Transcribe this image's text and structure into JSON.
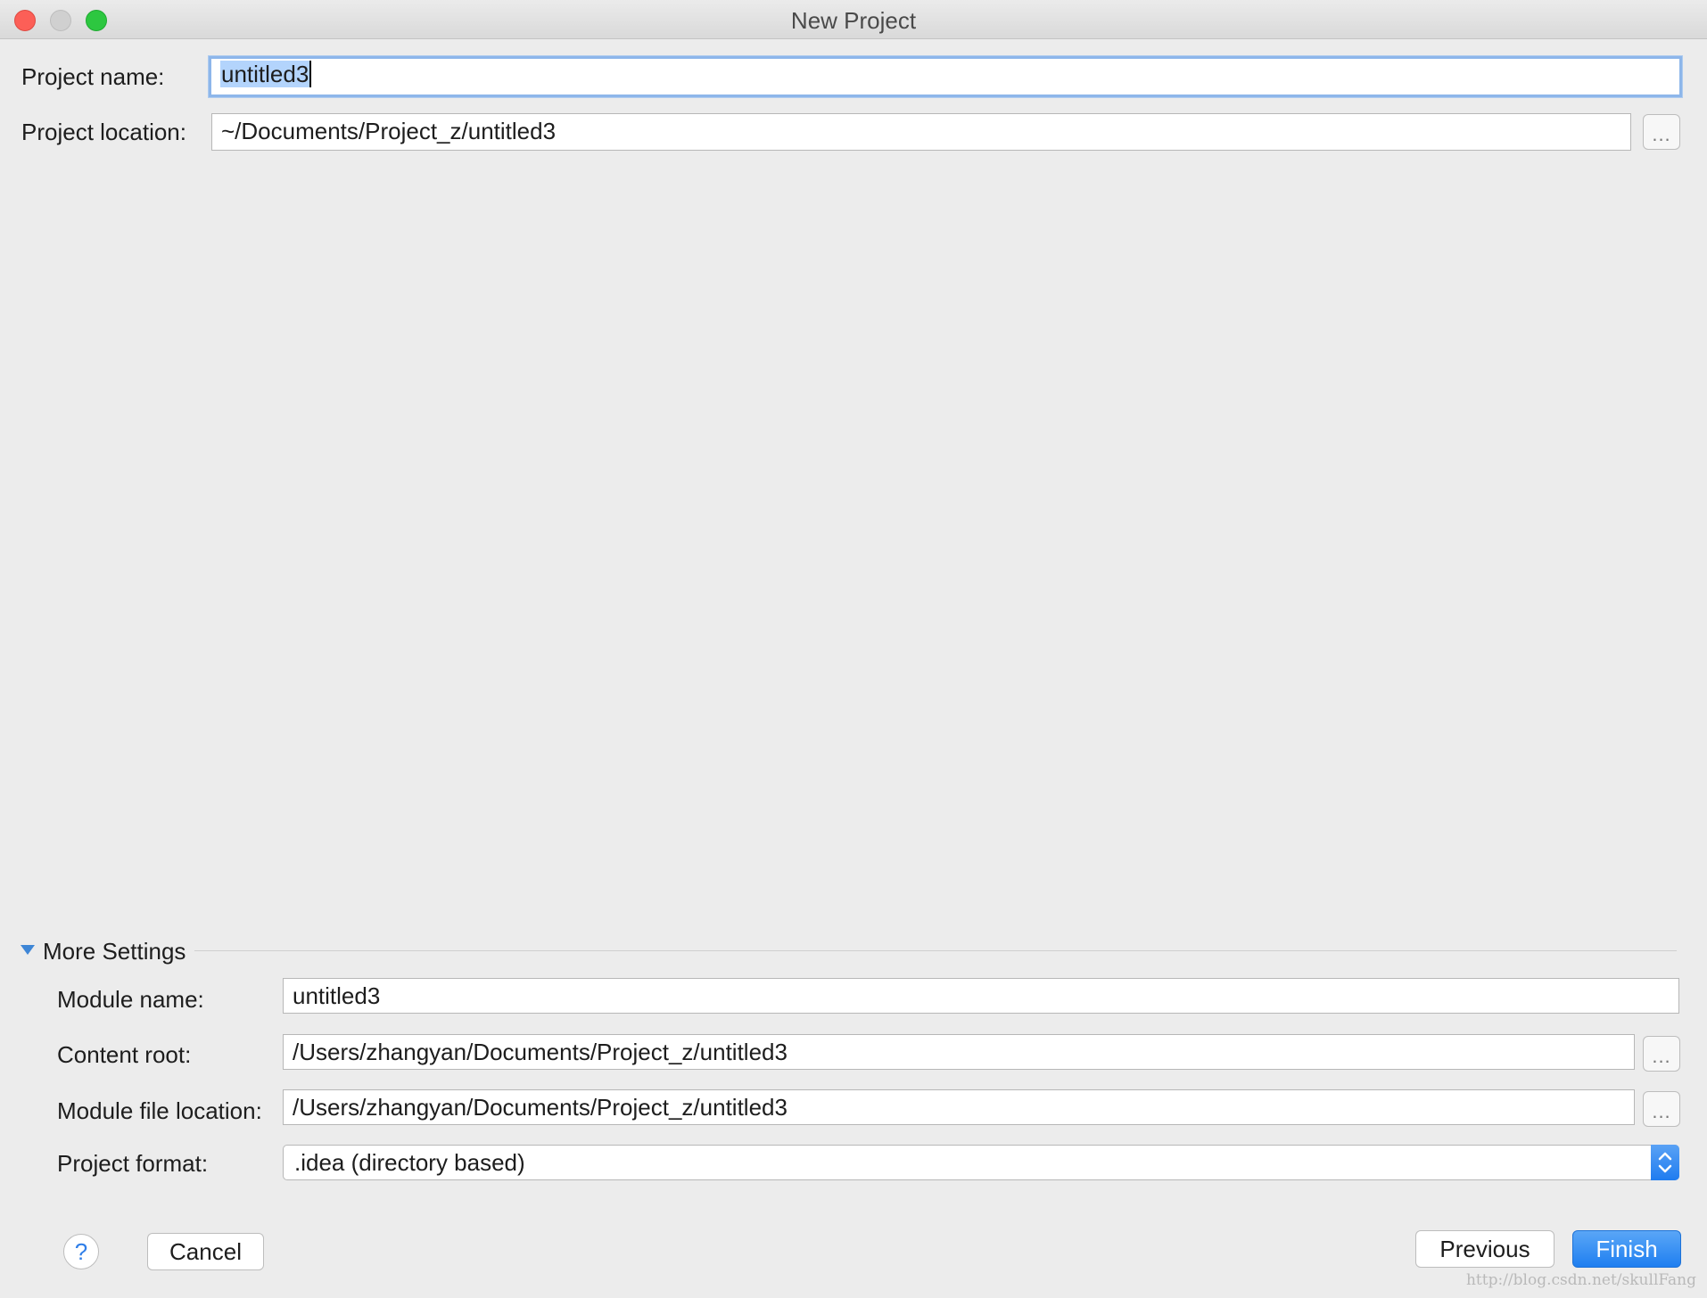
{
  "window": {
    "title": "New Project"
  },
  "project": {
    "name_label": "Project name:",
    "name_value": "untitled3",
    "location_label": "Project location:",
    "location_value": "~/Documents/Project_z/untitled3",
    "browse_label": "..."
  },
  "more_settings": {
    "title": "More Settings",
    "expanded": true,
    "module_name_label": "Module name:",
    "module_name_value": "untitled3",
    "content_root_label": "Content root:",
    "content_root_value": "/Users/zhangyan/Documents/Project_z/untitled3",
    "module_file_label": "Module file location:",
    "module_file_value": "/Users/zhangyan/Documents/Project_z/untitled3",
    "format_label": "Project format:",
    "format_value": ".idea (directory based)",
    "browse_label": "..."
  },
  "footer": {
    "help_label": "?",
    "cancel_label": "Cancel",
    "previous_label": "Previous",
    "finish_label": "Finish"
  },
  "watermark": "http://blog.csdn.net/skullFang",
  "colors": {
    "accent": "#2f7ee8",
    "selection": "#b3d4fc",
    "focus_ring": "#8db6ea",
    "close": "#fc5f57",
    "minimize": "#d0d0d0",
    "maximize": "#2dc740"
  },
  "icons": {
    "disclosure": "triangle-down-icon",
    "select_arrows": "up-down-chevron-icon",
    "help": "question-icon"
  }
}
